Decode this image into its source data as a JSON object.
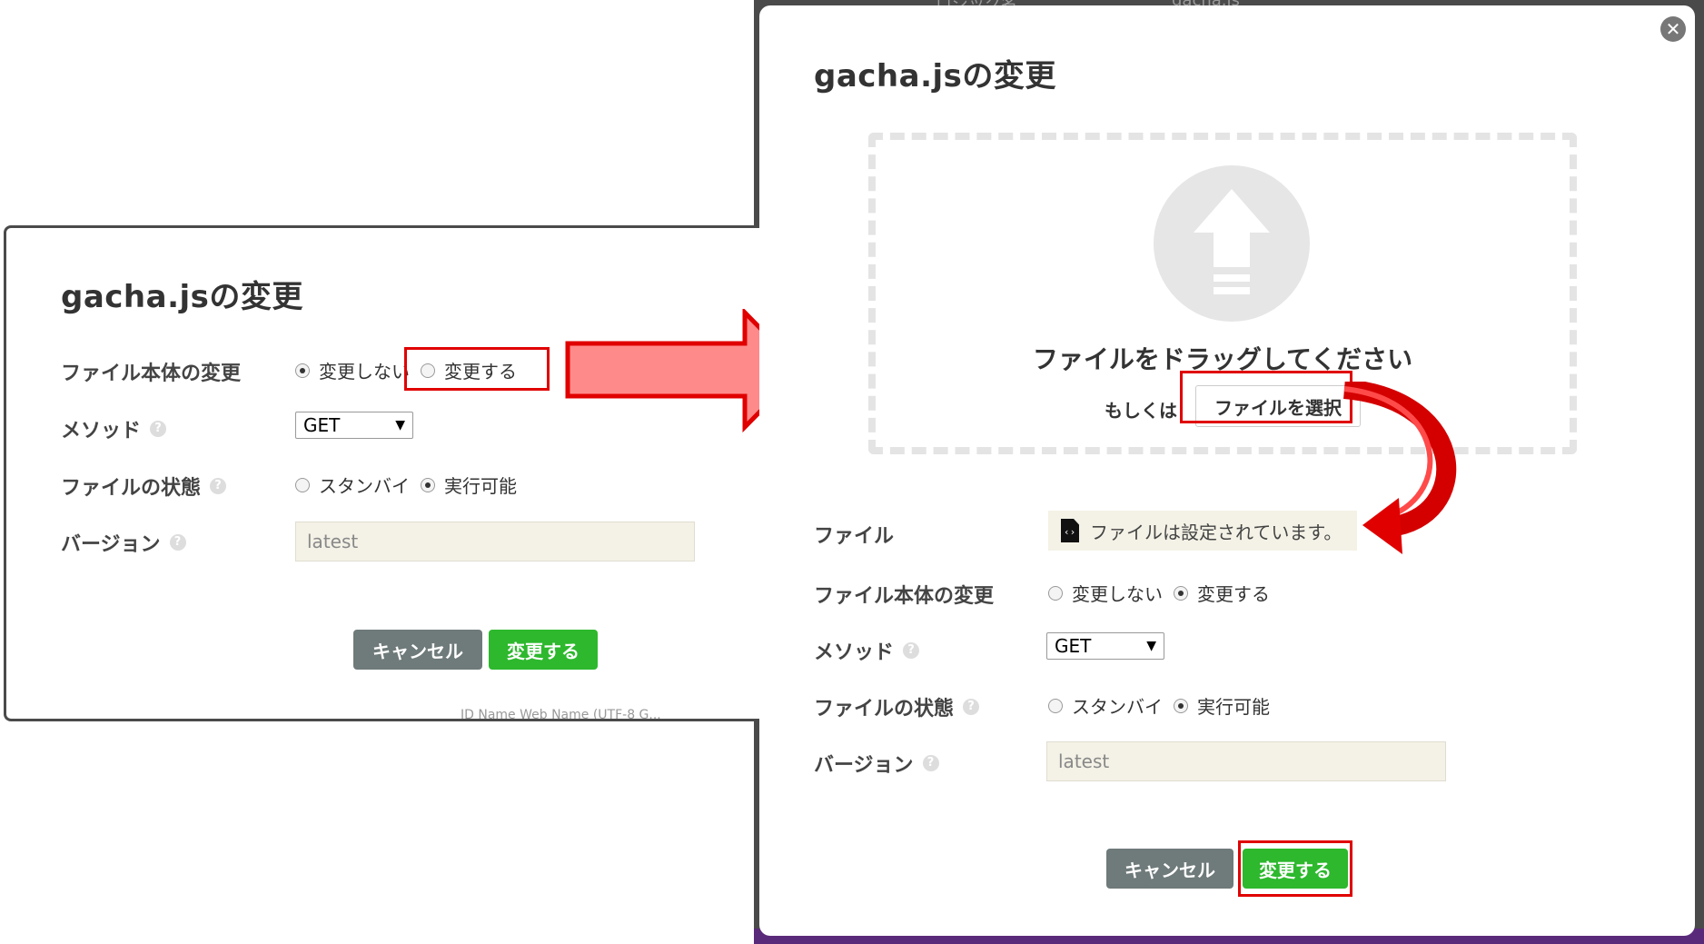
{
  "background": {
    "top_label": "ロジック名",
    "top_value": "gacha.js",
    "left_partial": "ID   Name       Web Name (UTF-8 G..."
  },
  "left_dialog": {
    "title": "gacha.jsの変更",
    "file_change_label": "ファイル本体の変更",
    "file_change_options": [
      "変更しない",
      "変更する"
    ],
    "file_change_selected": "変更しない",
    "method_label": "メソッド",
    "method_value": "GET",
    "state_label": "ファイルの状態",
    "state_options": [
      "スタンバイ",
      "実行可能"
    ],
    "state_selected": "実行可能",
    "version_label": "バージョン",
    "version_value": "latest",
    "cancel_label": "キャンセル",
    "submit_label": "変更する"
  },
  "right_dialog": {
    "title": "gacha.jsの変更",
    "drop_text": "ファイルをドラッグしてください",
    "or_text": "もしくは",
    "file_select_label": "ファイルを選択",
    "file_label": "ファイル",
    "file_status": "ファイルは設定されています。",
    "file_change_label": "ファイル本体の変更",
    "file_change_options": [
      "変更しない",
      "変更する"
    ],
    "file_change_selected": "変更する",
    "method_label": "メソッド",
    "method_value": "GET",
    "state_label": "ファイルの状態",
    "state_options": [
      "スタンバイ",
      "実行可能"
    ],
    "state_selected": "実行可能",
    "version_label": "バージョン",
    "version_value": "latest",
    "cancel_label": "キャンセル",
    "submit_label": "変更する",
    "close_glyph": "✕"
  },
  "help_glyph": "?",
  "select_caret": "▼",
  "colors": {
    "annotation_red": "#e00000",
    "arrow_fill": "#ff8a8a",
    "submit_green": "#2db82d",
    "cancel_gray": "#6f7a7a"
  }
}
